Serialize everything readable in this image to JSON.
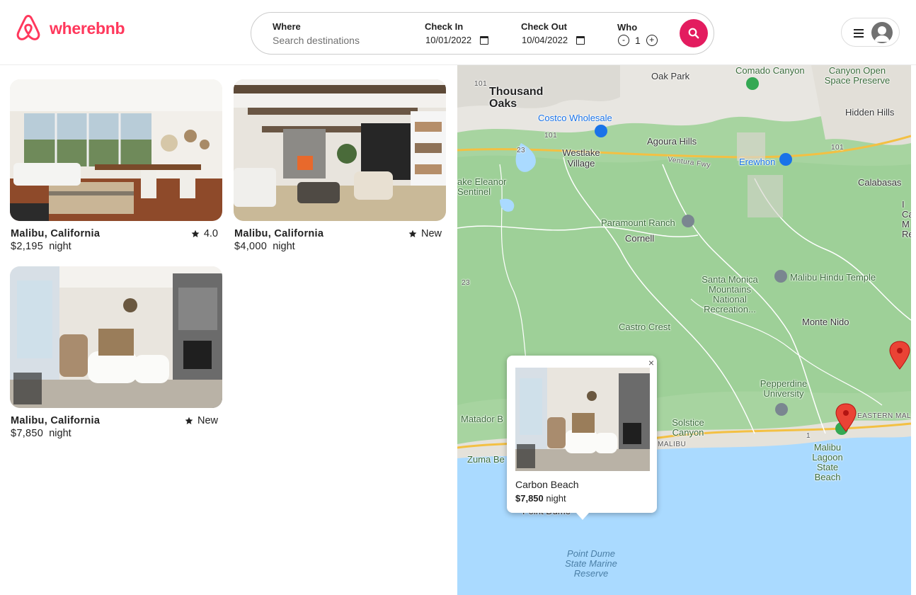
{
  "brand": {
    "name": "wherebnb",
    "color": "#ff385c",
    "logo_icon": "airbnb-belo-icon"
  },
  "search": {
    "where_label": "Where",
    "where_placeholder": "Search destinations",
    "checkin_label": "Check In",
    "checkin_value": "10/01/2022",
    "checkout_label": "Check Out",
    "checkout_value": "10/04/2022",
    "who_label": "Who",
    "who_minus": "-",
    "who_count": "1",
    "who_plus": "+",
    "button_icon": "search-icon",
    "button_color": "#e31c5f"
  },
  "user_menu": {
    "menu_icon": "hamburger-icon",
    "avatar_icon": "user-avatar-icon"
  },
  "listings": [
    {
      "location": "Malibu, California",
      "rating": "4.0",
      "price": "$2,195",
      "unit": "night"
    },
    {
      "location": "Malibu, California",
      "rating": "New",
      "price": "$4,000",
      "unit": "night"
    },
    {
      "location": "Malibu, California",
      "rating": "New",
      "price": "$7,850",
      "unit": "night"
    }
  ],
  "map": {
    "labels": {
      "oak_park": "Oak Park",
      "comado_canyon": "Comado Canyon",
      "canyon_open": "Canyon Open Space Preserve",
      "thousand_oaks": "Thousand Oaks",
      "hidden_hills": "Hidden Hills",
      "costco": "Costco Wholesale",
      "agoura_hills": "Agoura Hills",
      "westlake": "Westlake Village",
      "ventura_fwy": "Ventura Fwy",
      "erewhon": "Erewhon",
      "calabasas": "Calabasas",
      "lake_eleanor": "ake Eleanor Sentinel",
      "paramount": "Paramount Ranch",
      "cornell": "Cornell",
      "santa_monica_mtns": "Santa Monica Mountains National Recreation...",
      "malibu_hindu": "Malibu Hindu Temple",
      "castro_crest": "Castro Crest",
      "monte_nido": "Monte Nido",
      "pepperdine": "Pepperdine University",
      "matador": "Matador B",
      "solstice": "Solstice Canyon",
      "malibu_road": "MALIBU",
      "eastern_malibu": "EASTERN MALIBU",
      "zuma": "Zuma Be",
      "malibu_lagoon": "Malibu Lagoon State Beach",
      "point_dume": "Point Dume State Marine Reserve",
      "point_dume_land": "Point Dume",
      "route_101": "101",
      "route_23": "23",
      "route_1": "1",
      "right_edge": "I Ca M Re"
    }
  },
  "popup": {
    "title": "Carbon Beach",
    "price": "$7,850",
    "unit": "night",
    "close": "×"
  }
}
